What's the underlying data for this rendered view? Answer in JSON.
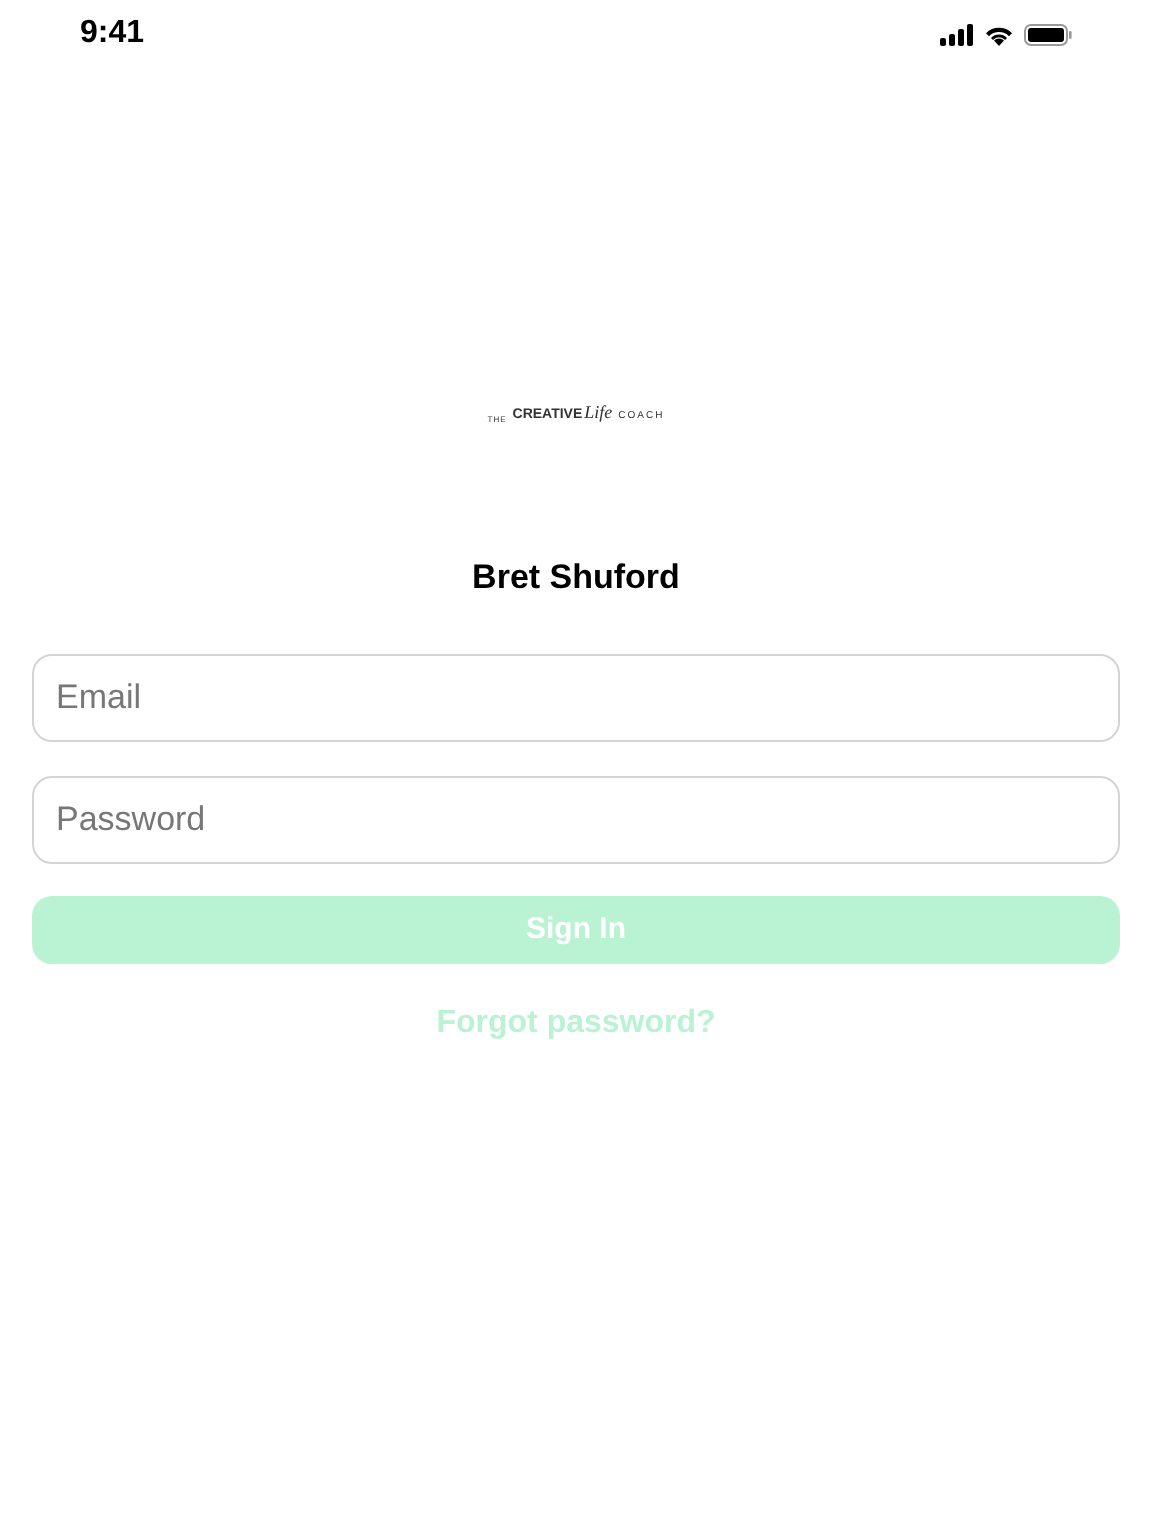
{
  "status_bar": {
    "time": "9:41"
  },
  "logo": {
    "parts": [
      "THE",
      "CREATIVE",
      "Life",
      "COACH"
    ]
  },
  "coach_name": "Bret Shuford",
  "fields": [
    {
      "placeholder": "Email"
    },
    {
      "placeholder": "Password"
    }
  ],
  "sign_in_button": {
    "label": "Sign In",
    "disabled": true
  },
  "forgot_link": {
    "label": "Forgot password?",
    "disabled": true
  }
}
